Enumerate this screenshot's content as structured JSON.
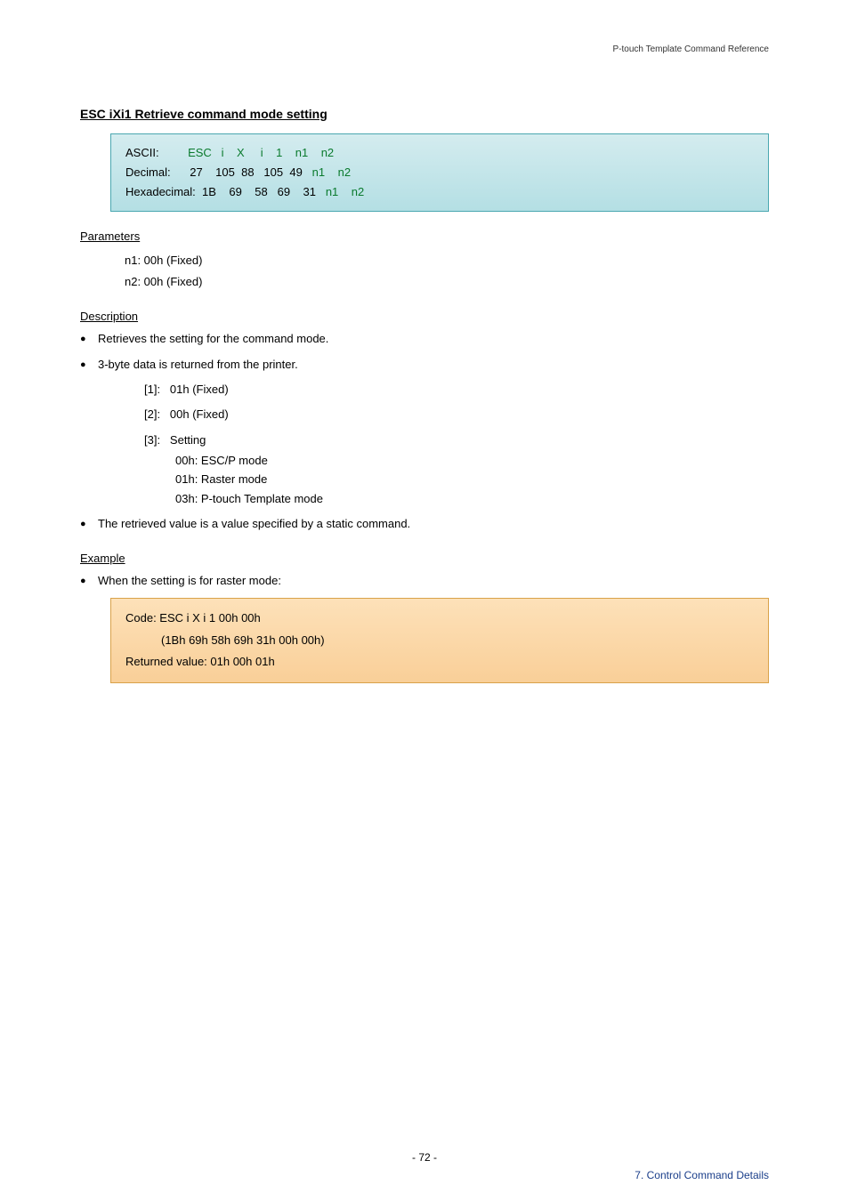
{
  "header": {
    "doc_title": "P-touch Template Command Reference"
  },
  "section": {
    "title": "ESC iXi1    Retrieve command mode setting"
  },
  "code_table": {
    "rows": {
      "ascii": {
        "label": "ASCII:",
        "vals": [
          "ESC",
          "i",
          "X",
          "i",
          "1",
          "n1",
          "n2"
        ]
      },
      "decimal": {
        "label": "Decimal:",
        "vals": [
          "27",
          "105",
          "88",
          "105",
          "49",
          "n1",
          "n2"
        ]
      },
      "hex": {
        "label": "Hexadecimal:",
        "vals": [
          "1B",
          "69",
          "58",
          "69",
          "31",
          "n1",
          "n2"
        ]
      }
    }
  },
  "parameters": {
    "heading": "Parameters",
    "lines": [
      "n1: 00h (Fixed)",
      "n2: 00h (Fixed)"
    ]
  },
  "description": {
    "heading": "Description",
    "bullets": [
      "Retrieves the setting for the command mode.",
      "3-byte data is returned from the printer."
    ],
    "sub": {
      "b1_label": "[1]:",
      "b1_text": "01h (Fixed)",
      "b2_label": "[2]:",
      "b2_text": "00h (Fixed)",
      "b3_label": "[3]:",
      "b3_text": "Setting",
      "b3_lines": [
        "00h: ESC/P mode",
        "01h: Raster mode",
        "03h: P-touch Template mode"
      ]
    },
    "bullet3": "The retrieved value is a value specified by a static command."
  },
  "example": {
    "heading": "Example",
    "bullet": "When the setting is for raster mode:",
    "line1": "Code: ESC i X i 1 00h 00h",
    "line2": "(1Bh 69h 58h 69h 31h 00h 00h)",
    "line3": "Returned value: 01h 00h 01h"
  },
  "footer": {
    "page": "- 72 -",
    "section": "7. Control Command Details"
  }
}
